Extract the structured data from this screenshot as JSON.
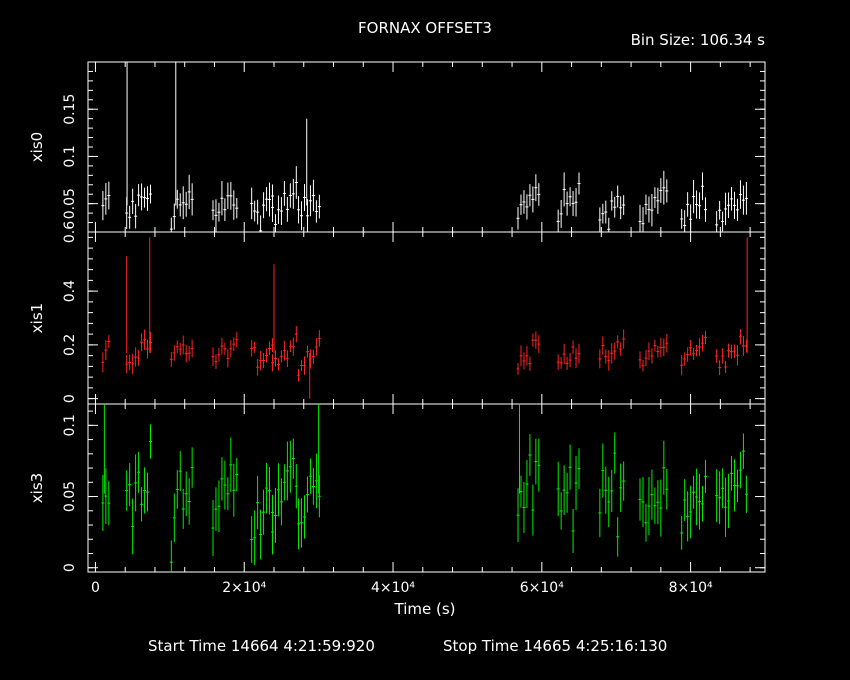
{
  "chart_data": {
    "type": "scatter",
    "title": "FORNAX OFFSET3",
    "bin_size_label": "Bin Size: 106.34 s",
    "xlabel": "Time (s)",
    "xlim": [
      -1000,
      90000
    ],
    "x_ticks": [
      {
        "value": 0,
        "label": "0"
      },
      {
        "value": 20000,
        "label": "2×10⁴"
      },
      {
        "value": 40000,
        "label": "4×10⁴"
      },
      {
        "value": 60000,
        "label": "6×10⁴"
      },
      {
        "value": 80000,
        "label": "8×10⁴"
      }
    ],
    "footer": {
      "start": "Start Time 14664  4:21:59:920",
      "stop": "Stop Time 14665  4:25:16:130"
    },
    "segments": [
      [
        1000,
        1800
      ],
      [
        4200,
        7500
      ],
      [
        10200,
        13300
      ],
      [
        15800,
        19200
      ],
      [
        21000,
        24000
      ],
      [
        23800,
        27000
      ],
      [
        27300,
        30200
      ],
      [
        56800,
        59800
      ],
      [
        62200,
        65200
      ],
      [
        67800,
        71300
      ],
      [
        73200,
        76900
      ],
      [
        78800,
        82000
      ],
      [
        83500,
        87600
      ]
    ],
    "panels": [
      {
        "name": "xis0",
        "color": "#ffffff",
        "ylim": [
          0.02,
          0.2
        ],
        "ticks": [
          {
            "value": 0.05,
            "label": "0.05"
          },
          {
            "value": 0.1,
            "label": "0.1"
          },
          {
            "value": 0.15,
            "label": "0.15"
          }
        ],
        "bottom_label": "0.6",
        "mean": 0.048,
        "spread": 0.013,
        "err": 0.014,
        "spikes": [
          [
            4250,
            0.2
          ],
          [
            10800,
            0.2
          ],
          [
            28400,
            0.14
          ]
        ]
      },
      {
        "name": "xis1",
        "color": "#ff2222",
        "ylim": [
          -0.02,
          0.62
        ],
        "ticks": [
          {
            "value": 0,
            "label": "0"
          },
          {
            "value": 0.2,
            "label": "0.2"
          },
          {
            "value": 0.4,
            "label": "0.4"
          }
        ],
        "bottom_label": "",
        "mean": 0.17,
        "spread": 0.03,
        "err": 0.03,
        "spikes": [
          [
            4200,
            0.53
          ],
          [
            7300,
            0.6
          ],
          [
            24000,
            0.5
          ],
          [
            87600,
            0.6
          ],
          [
            28800,
            0.0
          ]
        ]
      },
      {
        "name": "xis3",
        "color": "#00ee00",
        "ylim": [
          -0.003,
          0.115
        ],
        "ticks": [
          {
            "value": 0,
            "label": "0"
          },
          {
            "value": 0.05,
            "label": "0.05"
          },
          {
            "value": 0.1,
            "label": "0.1"
          }
        ],
        "bottom_label": "",
        "mean": 0.052,
        "spread": 0.018,
        "err": 0.016,
        "spikes": [
          [
            1200,
            0.115
          ],
          [
            30000,
            0.115
          ],
          [
            57000,
            0.115
          ]
        ]
      }
    ]
  }
}
